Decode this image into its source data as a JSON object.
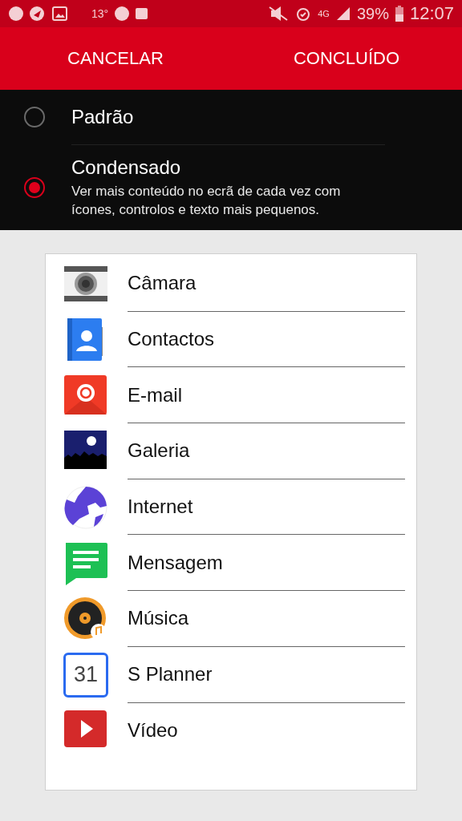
{
  "status_bar": {
    "temperature": "13°",
    "network": "4G",
    "battery": "39%",
    "time": "12:07"
  },
  "action_bar": {
    "buttons": [
      "CANCELAR",
      "CONCLUÍDO"
    ]
  },
  "options": [
    {
      "label": "Padrão",
      "selected": false
    },
    {
      "label": "Condensado",
      "description": "Ver mais conteúdo no ecrã de cada vez com ícones, controlos e texto mais pequenos.",
      "selected": true
    }
  ],
  "apps": [
    {
      "kind": "camera",
      "label": "Câmara"
    },
    {
      "kind": "contacts",
      "label": "Contactos"
    },
    {
      "kind": "email",
      "label": "E-mail"
    },
    {
      "kind": "gallery",
      "label": "Galeria"
    },
    {
      "kind": "internet",
      "label": "Internet"
    },
    {
      "kind": "messages",
      "label": "Mensagem"
    },
    {
      "kind": "music",
      "label": "Música"
    },
    {
      "kind": "planner",
      "label": "S Planner",
      "icon_text": "31"
    },
    {
      "kind": "video",
      "label": "Vídeo"
    }
  ]
}
